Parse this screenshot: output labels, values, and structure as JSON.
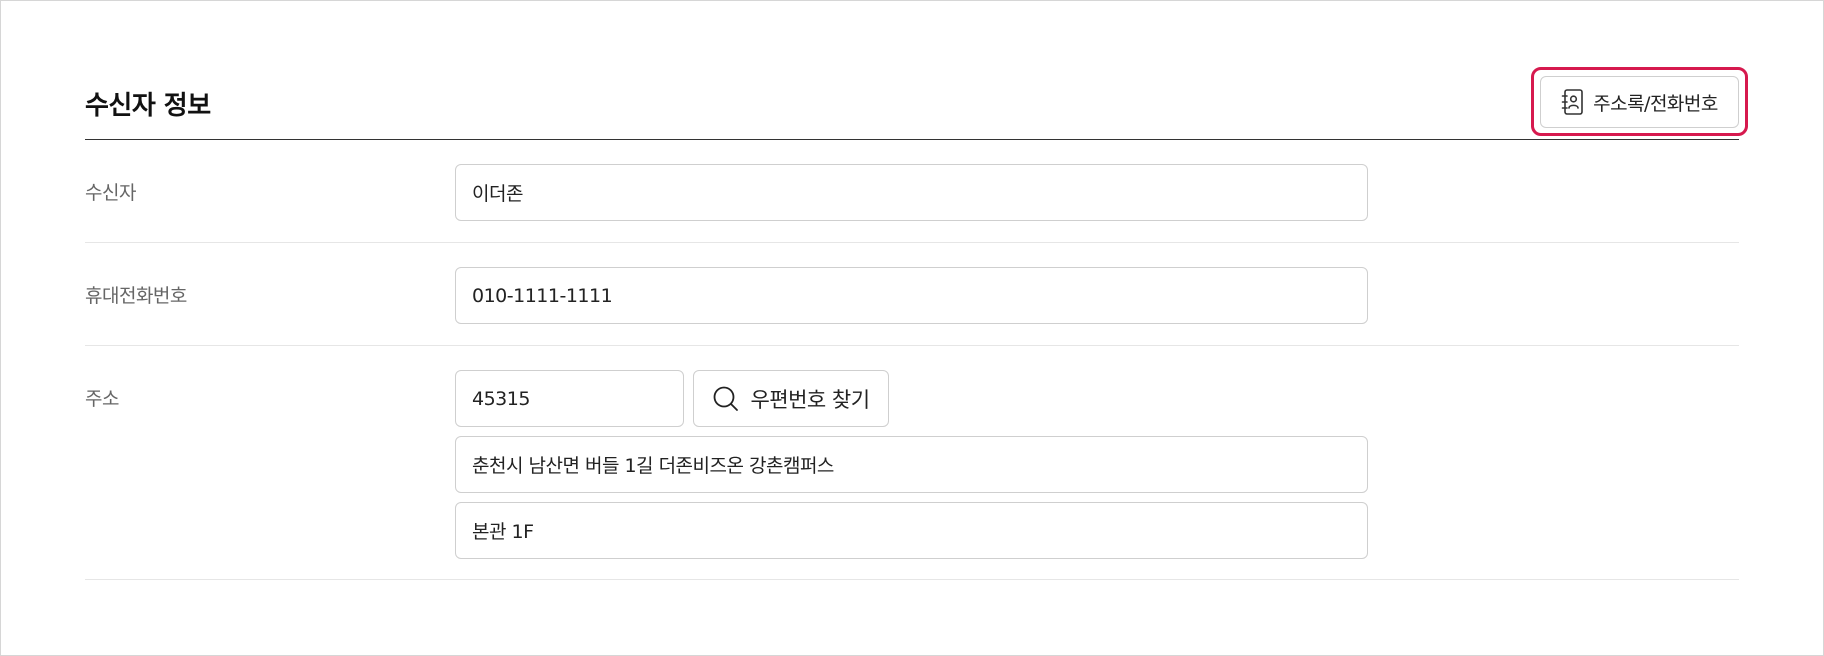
{
  "section": {
    "title": "수신자 정보",
    "address_book_button": {
      "label": "주소록/전화번호",
      "icon": "address-book-icon",
      "highlight_color": "#d6194e"
    }
  },
  "form": {
    "recipient": {
      "label": "수신자",
      "value": "이더존"
    },
    "mobile": {
      "label": "휴대전화번호",
      "value": "010-1111-1111"
    },
    "address": {
      "label": "주소",
      "zipcode": "45315",
      "zip_search_button": {
        "label": "우편번호 찾기",
        "icon": "search-icon"
      },
      "line1": "춘천시 남산면 버들 1길 더존비즈온 강촌캠퍼스",
      "line2": "본관 1F"
    }
  }
}
